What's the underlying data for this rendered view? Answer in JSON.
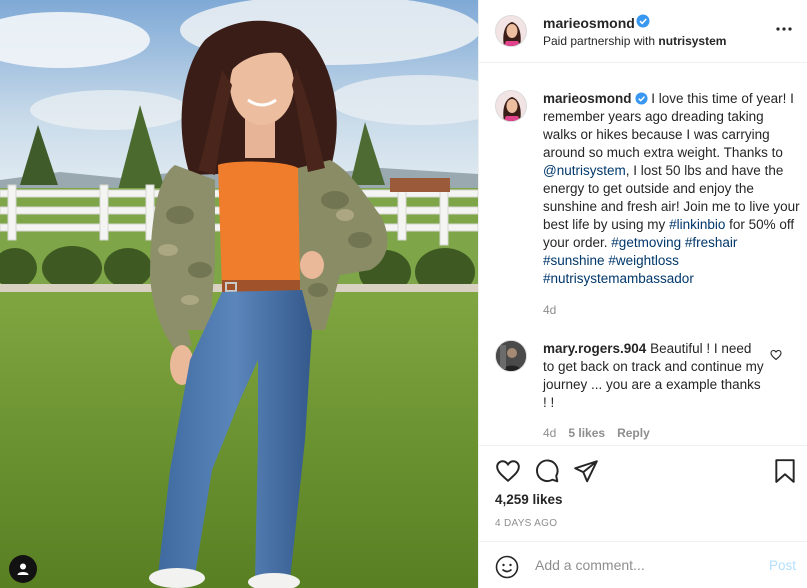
{
  "photo": {
    "alt_icon": "user-tag-icon"
  },
  "header": {
    "username": "marieosmond",
    "partner_prefix": "Paid partnership with ",
    "partner_name": "nutrisystem",
    "more_icon": "more-options-icon"
  },
  "caption": {
    "username": "marieosmond",
    "text_1": " I love this time of year! I remember years ago dreading taking walks or hikes because I was carrying around so much extra weight. Thanks to ",
    "mention": "@nutrisystem",
    "text_2": ", I lost 50 lbs and have the energy to get outside and enjoy the sunshine and fresh air! Join me to live your best life by using my ",
    "tag_linkinbio": "#linkinbio",
    "text_3": " for 50% off your order. ",
    "tag_getmoving": "#getmoving",
    "tag_freshair": "#freshair",
    "tag_sunshine": "#sunshine",
    "tag_weightloss": "#weightloss",
    "tag_ambassador": "#nutrisystemambassador",
    "time": "4d"
  },
  "comment": {
    "username": "mary.rogers.904",
    "text": " Beautiful ! I need to get back on track and continue my journey ... you are a example thanks ! !",
    "time": "4d",
    "likes": "5 likes",
    "reply": "Reply"
  },
  "actions": {
    "likes": "4,259 likes",
    "ago": "4 DAYS AGO",
    "icons": [
      "heart-icon",
      "comment-icon",
      "share-icon",
      "bookmark-icon"
    ]
  },
  "add_comment": {
    "placeholder": "Add a comment...",
    "post_label": "Post"
  },
  "colors": {
    "link": "#00376b",
    "verified": "#3897f0",
    "post_disabled": "#b2dffc"
  }
}
